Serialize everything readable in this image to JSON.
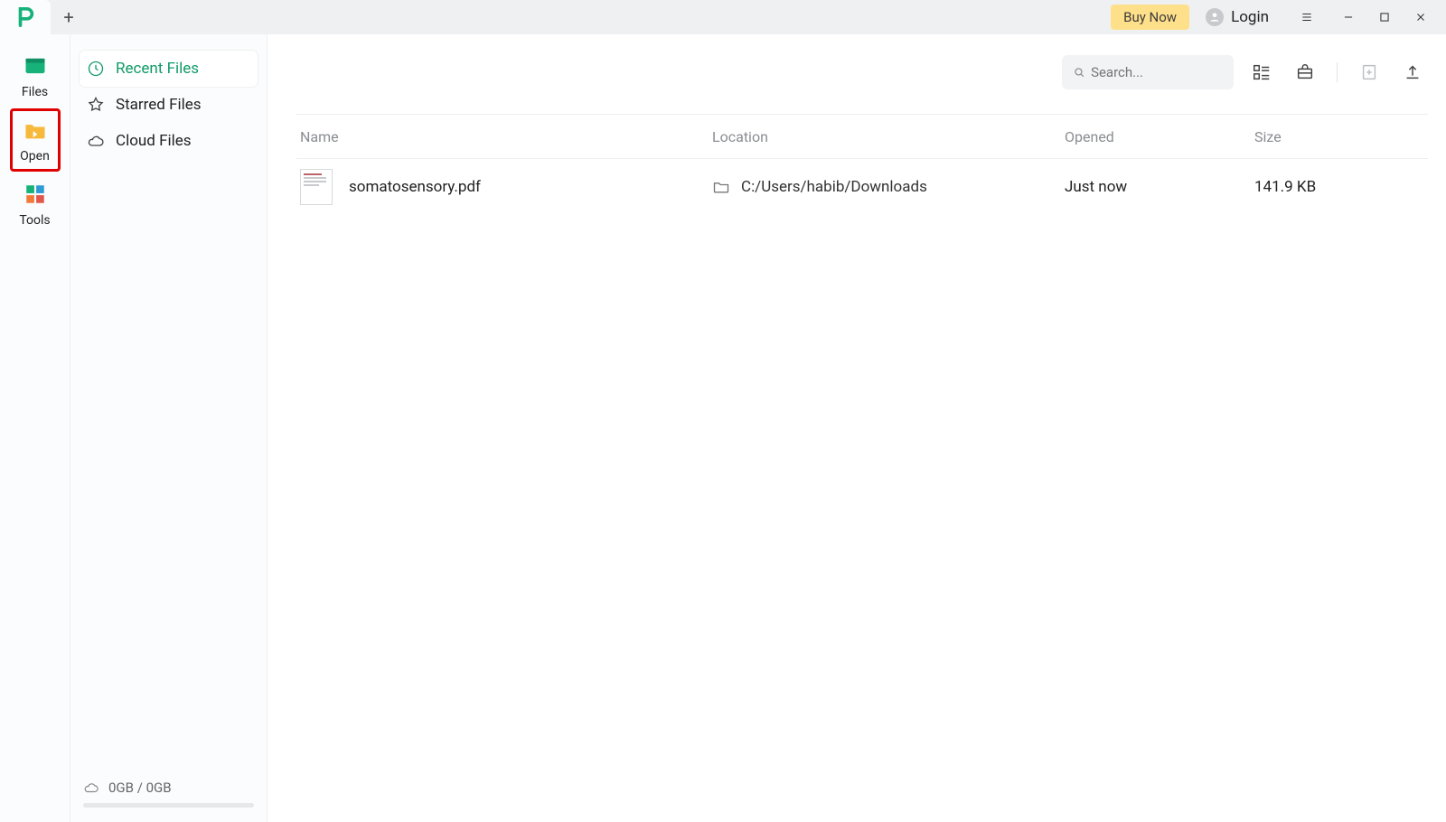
{
  "titlebar": {
    "buy_now": "Buy Now",
    "login": "Login"
  },
  "rail": {
    "items": [
      {
        "label": "Files"
      },
      {
        "label": "Open"
      },
      {
        "label": "Tools"
      }
    ]
  },
  "sidebar": {
    "items": [
      {
        "label": "Recent Files"
      },
      {
        "label": "Starred Files"
      },
      {
        "label": "Cloud Files"
      }
    ],
    "storage": "0GB / 0GB"
  },
  "toolbar": {
    "search_placeholder": "Search..."
  },
  "table": {
    "headers": {
      "name": "Name",
      "location": "Location",
      "opened": "Opened",
      "size": "Size"
    },
    "rows": [
      {
        "name": "somatosensory.pdf",
        "location": "C:/Users/habib/Downloads",
        "opened": "Just now",
        "size": "141.9 KB"
      }
    ]
  }
}
